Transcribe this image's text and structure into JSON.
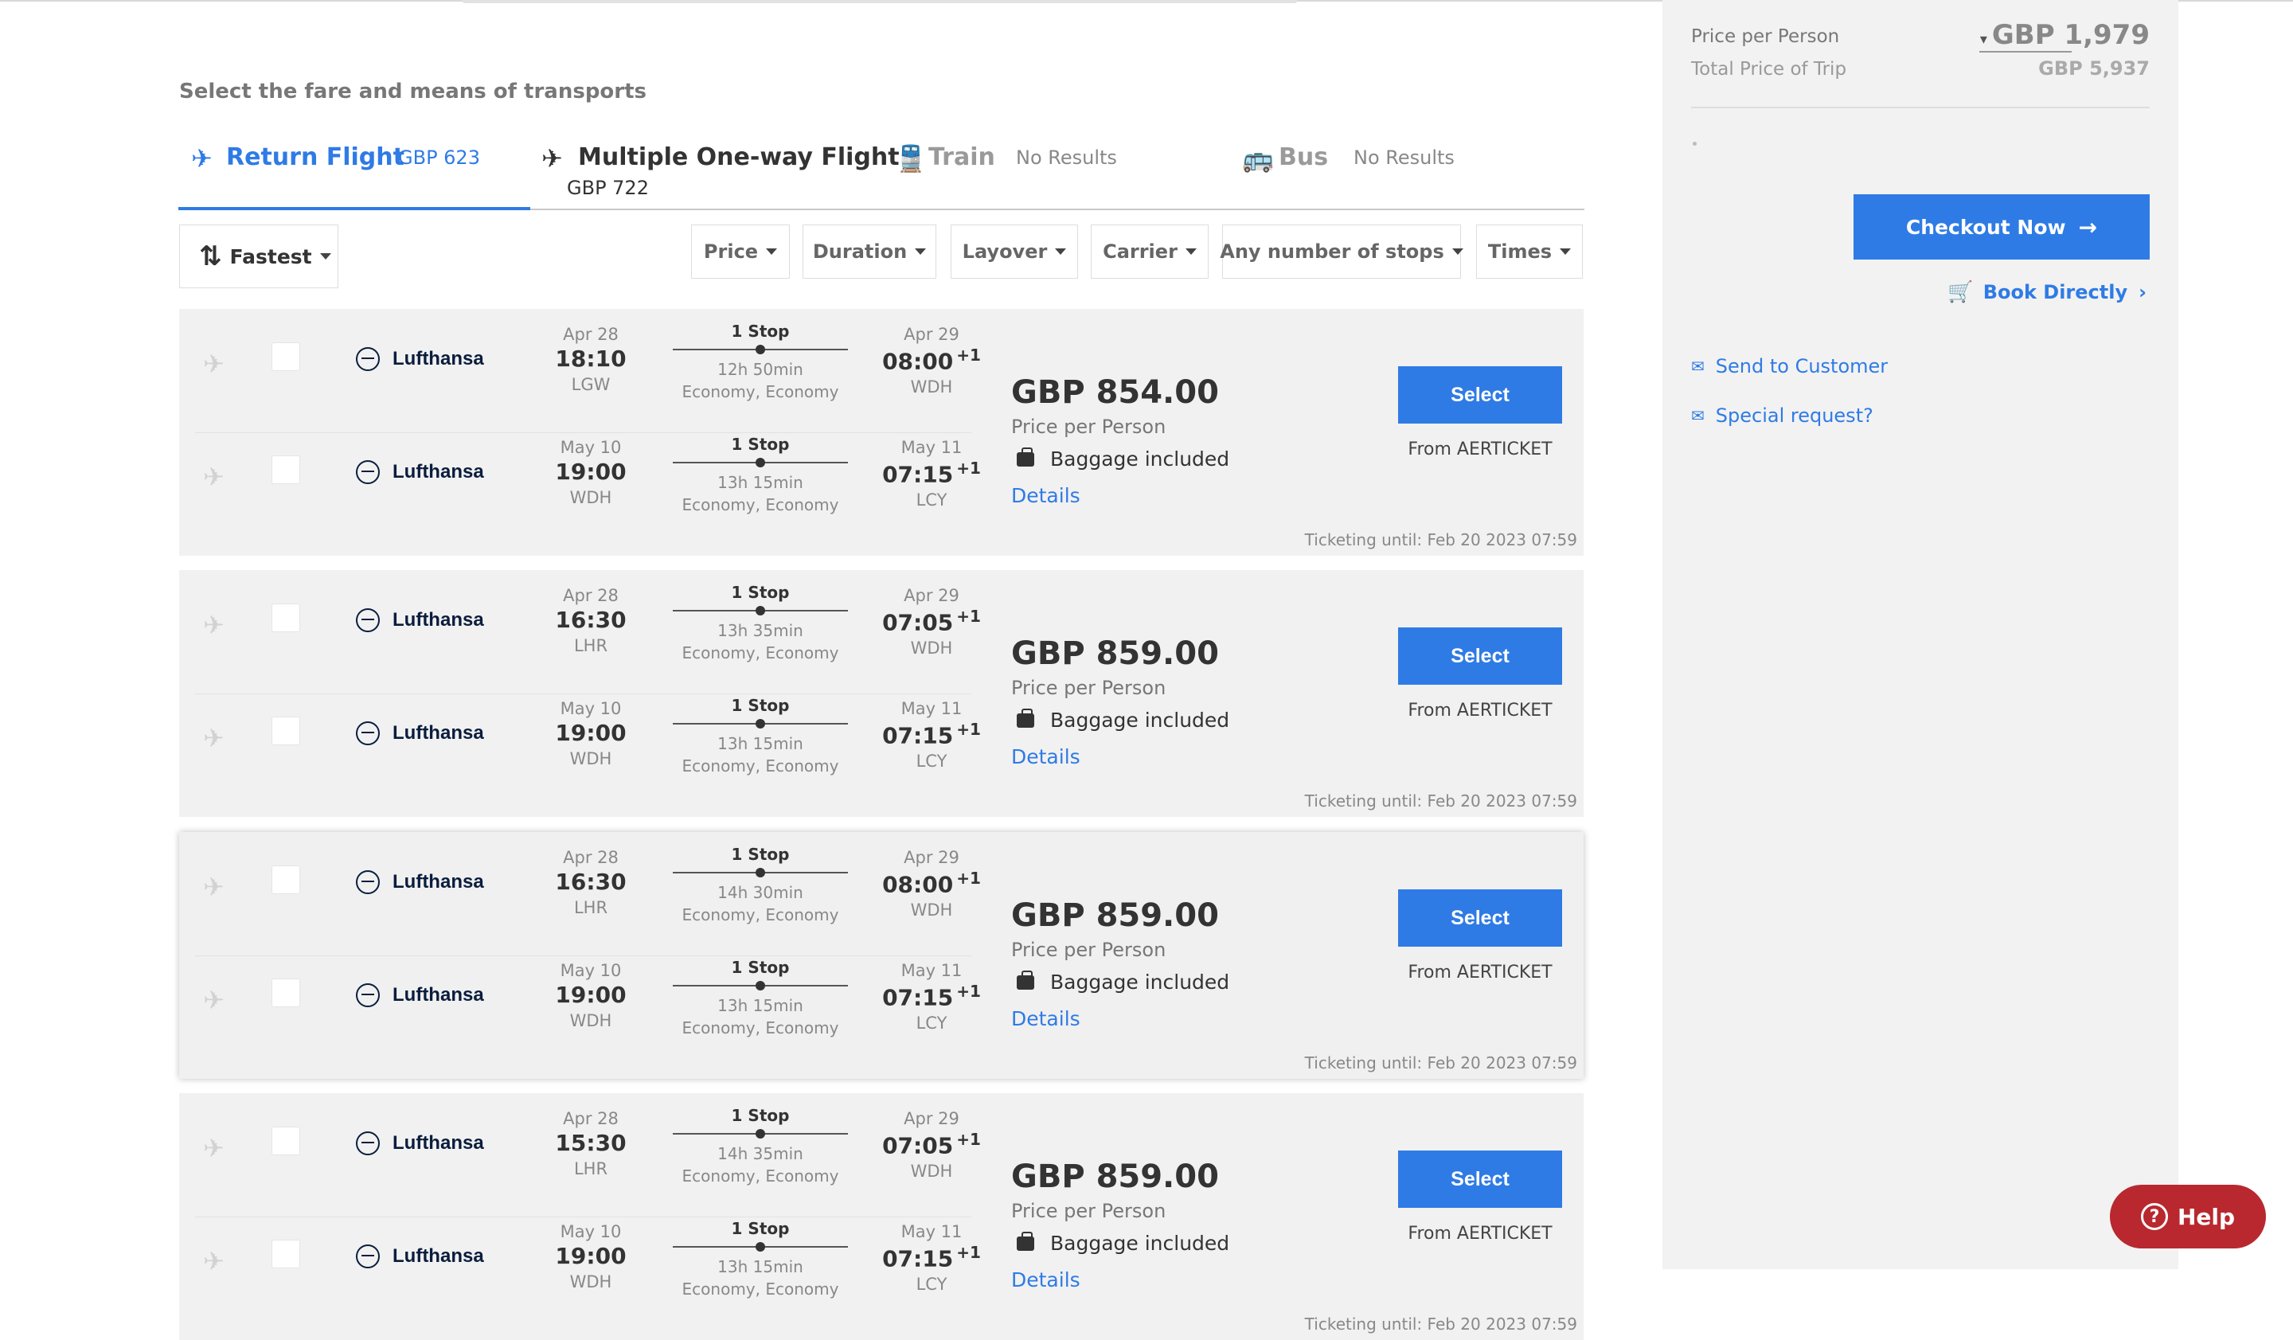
{
  "section_title": "Select the fare and means of transports",
  "tabs": [
    {
      "label": "Return Flight",
      "sub": "GBP 623",
      "icon": "plane-icon"
    },
    {
      "label": "Multiple One-way Flight",
      "sub": "GBP 722",
      "icon": "plane-icon"
    },
    {
      "label": "Train",
      "sub": "No Results",
      "icon": "train-icon"
    },
    {
      "label": "Bus",
      "sub": "No Results",
      "icon": "bus-icon"
    }
  ],
  "sort": {
    "label": "Fastest"
  },
  "filters": [
    "Price",
    "Duration",
    "Layover",
    "Carrier",
    "Any number of stops",
    "Times"
  ],
  "results": [
    {
      "price": "GBP 854.00",
      "per_person": "Price per Person",
      "baggage": "Baggage included",
      "details": "Details",
      "select": "Select",
      "from": "From AERTICKET",
      "ticketing": "Ticketing until: Feb 20 2023 07:59",
      "segments": [
        {
          "airline": "Lufthansa",
          "dep_date": "Apr 28",
          "dep_time": "18:10",
          "dep_ap": "LGW",
          "stops": "1 Stop",
          "duration": "12h 50min",
          "cabin": "Economy, Economy",
          "arr_date": "Apr 29",
          "arr_time": "08:00",
          "arr_plus": "+1",
          "arr_ap": "WDH"
        },
        {
          "airline": "Lufthansa",
          "dep_date": "May 10",
          "dep_time": "19:00",
          "dep_ap": "WDH",
          "stops": "1 Stop",
          "duration": "13h 15min",
          "cabin": "Economy, Economy",
          "arr_date": "May 11",
          "arr_time": "07:15",
          "arr_plus": "+1",
          "arr_ap": "LCY"
        }
      ]
    },
    {
      "price": "GBP 859.00",
      "per_person": "Price per Person",
      "baggage": "Baggage included",
      "details": "Details",
      "select": "Select",
      "from": "From AERTICKET",
      "ticketing": "Ticketing until: Feb 20 2023 07:59",
      "segments": [
        {
          "airline": "Lufthansa",
          "dep_date": "Apr 28",
          "dep_time": "16:30",
          "dep_ap": "LHR",
          "stops": "1 Stop",
          "duration": "13h 35min",
          "cabin": "Economy, Economy",
          "arr_date": "Apr 29",
          "arr_time": "07:05",
          "arr_plus": "+1",
          "arr_ap": "WDH"
        },
        {
          "airline": "Lufthansa",
          "dep_date": "May 10",
          "dep_time": "19:00",
          "dep_ap": "WDH",
          "stops": "1 Stop",
          "duration": "13h 15min",
          "cabin": "Economy, Economy",
          "arr_date": "May 11",
          "arr_time": "07:15",
          "arr_plus": "+1",
          "arr_ap": "LCY"
        }
      ]
    },
    {
      "price": "GBP 859.00",
      "per_person": "Price per Person",
      "baggage": "Baggage included",
      "details": "Details",
      "select": "Select",
      "from": "From AERTICKET",
      "ticketing": "Ticketing until: Feb 20 2023 07:59",
      "segments": [
        {
          "airline": "Lufthansa",
          "dep_date": "Apr 28",
          "dep_time": "16:30",
          "dep_ap": "LHR",
          "stops": "1 Stop",
          "duration": "14h 30min",
          "cabin": "Economy, Economy",
          "arr_date": "Apr 29",
          "arr_time": "08:00",
          "arr_plus": "+1",
          "arr_ap": "WDH"
        },
        {
          "airline": "Lufthansa",
          "dep_date": "May 10",
          "dep_time": "19:00",
          "dep_ap": "WDH",
          "stops": "1 Stop",
          "duration": "13h 15min",
          "cabin": "Economy, Economy",
          "arr_date": "May 11",
          "arr_time": "07:15",
          "arr_plus": "+1",
          "arr_ap": "LCY"
        }
      ]
    },
    {
      "price": "GBP 859.00",
      "per_person": "Price per Person",
      "baggage": "Baggage included",
      "details": "Details",
      "select": "Select",
      "from": "From AERTICKET",
      "ticketing": "Ticketing until: Feb 20 2023 07:59",
      "segments": [
        {
          "airline": "Lufthansa",
          "dep_date": "Apr 28",
          "dep_time": "15:30",
          "dep_ap": "LHR",
          "stops": "1 Stop",
          "duration": "14h 35min",
          "cabin": "Economy, Economy",
          "arr_date": "Apr 29",
          "arr_time": "07:05",
          "arr_plus": "+1",
          "arr_ap": "WDH"
        },
        {
          "airline": "Lufthansa",
          "dep_date": "May 10",
          "dep_time": "19:00",
          "dep_ap": "WDH",
          "stops": "1 Stop",
          "duration": "13h 15min",
          "cabin": "Economy, Economy",
          "arr_date": "May 11",
          "arr_time": "07:15",
          "arr_plus": "+1",
          "arr_ap": "LCY"
        }
      ]
    }
  ],
  "sidebar": {
    "price_per_person_label": "Price per Person",
    "price_per_person_value": "GBP 1,979",
    "total_label": "Total Price of Trip",
    "total_value": "GBP 5,937",
    "checkout": "Checkout Now",
    "book_directly": "Book Directly",
    "send_to_customer": "Send to Customer",
    "special_request": "Special request?"
  },
  "help": "Help",
  "colors": {
    "accent": "#2f7be5",
    "help": "#b8282e"
  }
}
